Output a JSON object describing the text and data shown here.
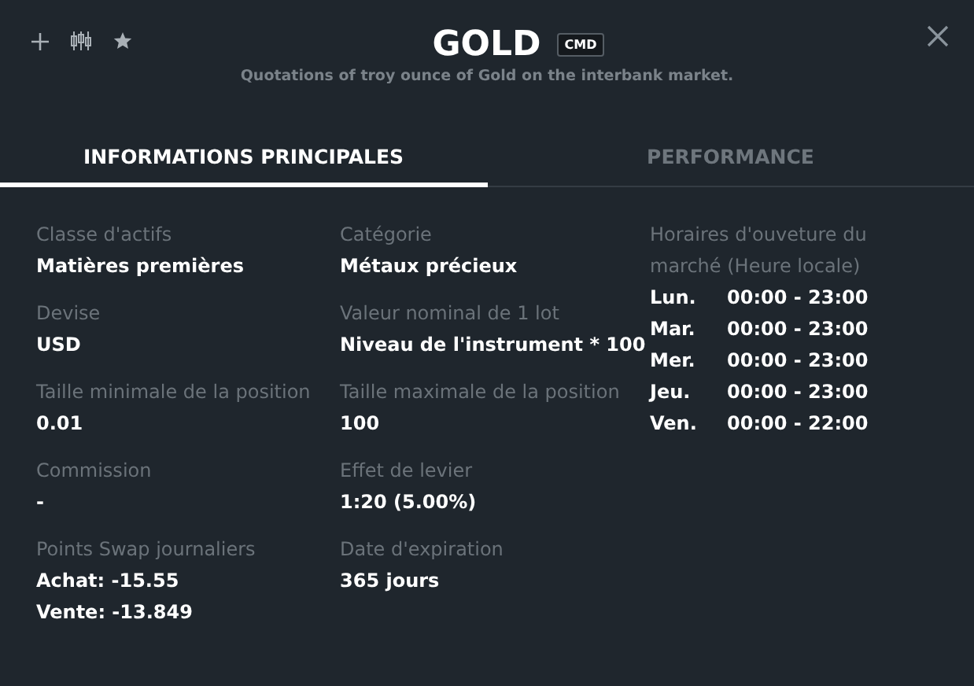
{
  "header": {
    "title": "GOLD",
    "badge": "CMD",
    "subtitle": "Quotations of troy ounce of Gold on the interbank market."
  },
  "tabs": [
    {
      "label": "INFORMATIONS PRINCIPALES",
      "selected": true
    },
    {
      "label": "PERFORMANCE",
      "selected": false
    }
  ],
  "columns": [
    {
      "fields": [
        {
          "label": "Classe d'actifs",
          "values": [
            "Matières premières"
          ]
        },
        {
          "label": "Devise",
          "values": [
            "USD"
          ]
        },
        {
          "label": "Taille minimale de la position",
          "values": [
            "0.01"
          ]
        },
        {
          "label": "Commission",
          "values": [
            "-"
          ]
        },
        {
          "label": "Points Swap journaliers",
          "values": [
            "Achat: -15.55",
            "Vente: -13.849"
          ]
        }
      ]
    },
    {
      "fields": [
        {
          "label": "Catégorie",
          "values": [
            "Métaux précieux"
          ]
        },
        {
          "label": "Valeur nominal de 1 lot",
          "values": [
            "Niveau de l'instrument * 100"
          ]
        },
        {
          "label": "Taille maximale de la position",
          "values": [
            "100"
          ]
        },
        {
          "label": "Effet de levier",
          "values": [
            "1:20 (5.00%)"
          ]
        },
        {
          "label": "Date d'expiration",
          "values": [
            "365 jours"
          ]
        }
      ]
    }
  ],
  "hours": {
    "label": "Horaires d'ouveture du marché (Heure locale)",
    "rows": [
      {
        "day": "Lun.",
        "time": "00:00 - 23:00"
      },
      {
        "day": "Mar.",
        "time": "00:00 - 23:00"
      },
      {
        "day": "Mer.",
        "time": "00:00 - 23:00"
      },
      {
        "day": "Jeu.",
        "time": "00:00 - 23:00"
      },
      {
        "day": "Ven.",
        "time": "00:00 - 22:00"
      }
    ]
  }
}
